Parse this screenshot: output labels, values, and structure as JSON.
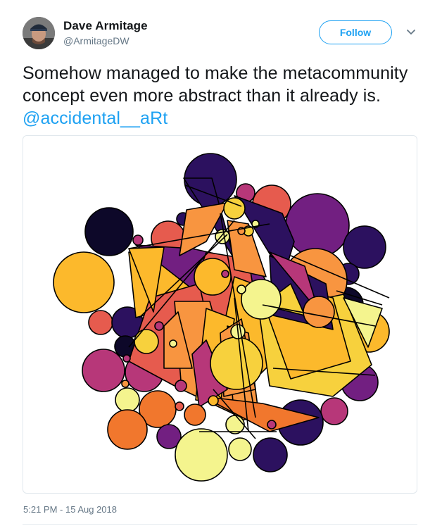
{
  "author": {
    "name": "Dave Armitage",
    "handle": "@ArmitageDW",
    "avatar_icon": "user-photo"
  },
  "follow_button": {
    "label": "Follow"
  },
  "menu": {
    "icon": "chevron-down-icon"
  },
  "tweet": {
    "text": "Somehow managed to make the metacommunity concept even more abstract than it already is.",
    "mention": "@accidental__aRt"
  },
  "media": {
    "description_icon": "generative-art-image",
    "palette": [
      "#0d0829",
      "#2c115f",
      "#721f81",
      "#b73779",
      "#e65b4e",
      "#f1772d",
      "#f89540",
      "#fcb92c",
      "#f7d13d",
      "#f4f48e"
    ]
  },
  "timestamp": "5:21 PM - 15 Aug 2018",
  "colors": {
    "link": "#1da1f2",
    "secondary_text": "#657786",
    "border": "#e1e8ed"
  }
}
